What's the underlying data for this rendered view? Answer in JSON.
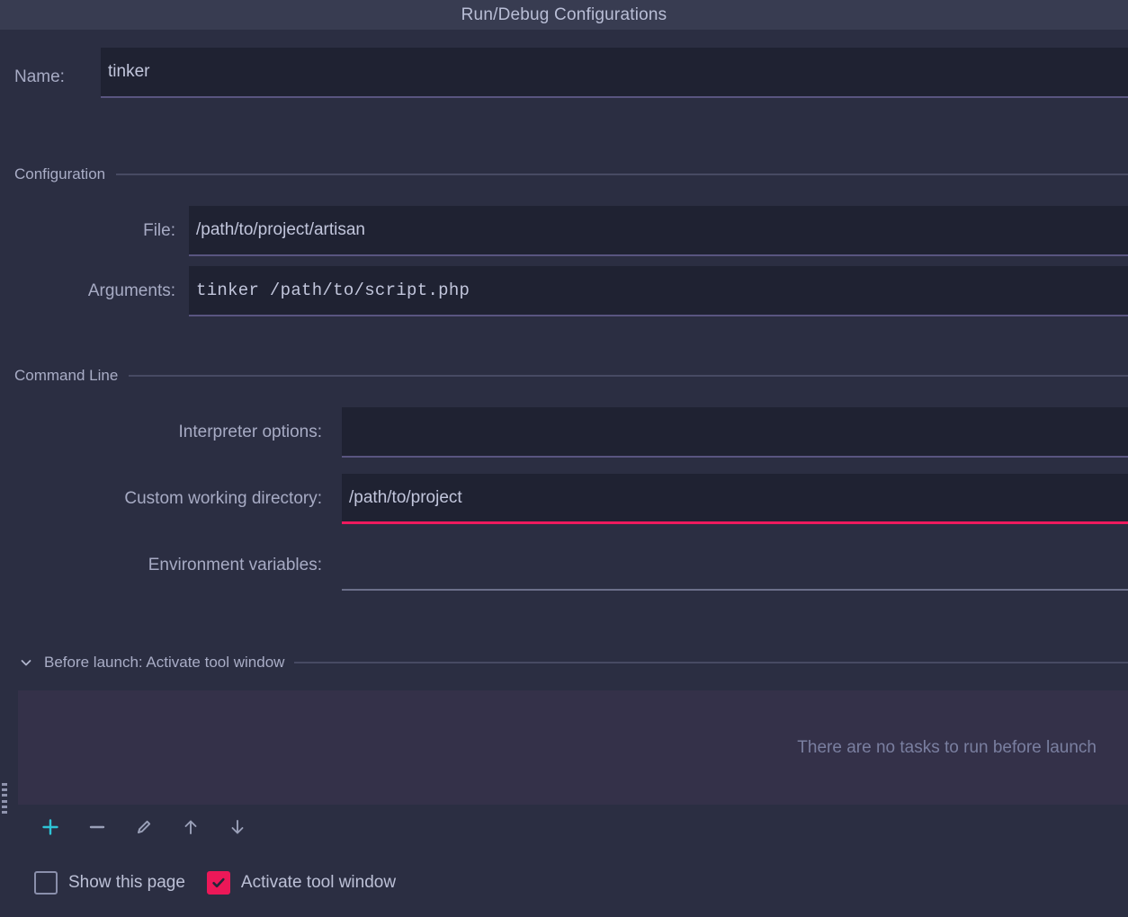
{
  "window": {
    "title": "Run/Debug Configurations"
  },
  "name_row": {
    "label": "Name:",
    "value": "tinker",
    "placeholder": ""
  },
  "sections": {
    "configuration": {
      "title": "Configuration",
      "fields": [
        {
          "label": "File:",
          "value": "/path/to/project/artisan",
          "mono": false
        },
        {
          "label": "Arguments:",
          "value": "tinker /path/to/script.php",
          "mono": true
        }
      ]
    },
    "command_line": {
      "title": "Command Line",
      "fields": [
        {
          "label": "Interpreter options:",
          "value": "",
          "state": "normal"
        },
        {
          "label": "Custom working directory:",
          "value": "/path/to/project",
          "state": "error"
        },
        {
          "label": "Environment variables:",
          "value": "",
          "state": "hover"
        }
      ]
    }
  },
  "before_launch": {
    "title": "Before launch: Activate tool window",
    "chevron_icon": "chevron-down-icon",
    "empty_message": "There are no tasks to run before launch",
    "toolbar": [
      {
        "name": "add-task-button",
        "icon": "plus-icon",
        "glyph": "+"
      },
      {
        "name": "remove-task-button",
        "icon": "minus-icon",
        "glyph": "−"
      },
      {
        "name": "edit-task-button",
        "icon": "pencil-icon",
        "glyph": "✎"
      },
      {
        "name": "move-up-button",
        "icon": "arrow-up-icon",
        "glyph": "↑"
      },
      {
        "name": "move-down-button",
        "icon": "arrow-down-icon",
        "glyph": "↓"
      }
    ]
  },
  "options": [
    {
      "label": "Show this page",
      "checked": false
    },
    {
      "label": "Activate tool window",
      "checked": true
    }
  ],
  "colors": {
    "dialog_background": "#2b2e42",
    "titlebar_background": "#383c51",
    "input_background": "#1f2232",
    "underline": "#595580",
    "underline_hover": "#6b6f8a",
    "error_accent": "#ee1a5e",
    "checkbox_accent": "#ec1858",
    "add_icon_accent": "#2ec4d6",
    "icon_gray": "#9aa0b8",
    "text_primary": "#c2c6dc",
    "text_label": "#a7abc4",
    "text_muted": "#7a7fa0",
    "tasks_panel_background": "#343149",
    "rule": "#474a63"
  }
}
